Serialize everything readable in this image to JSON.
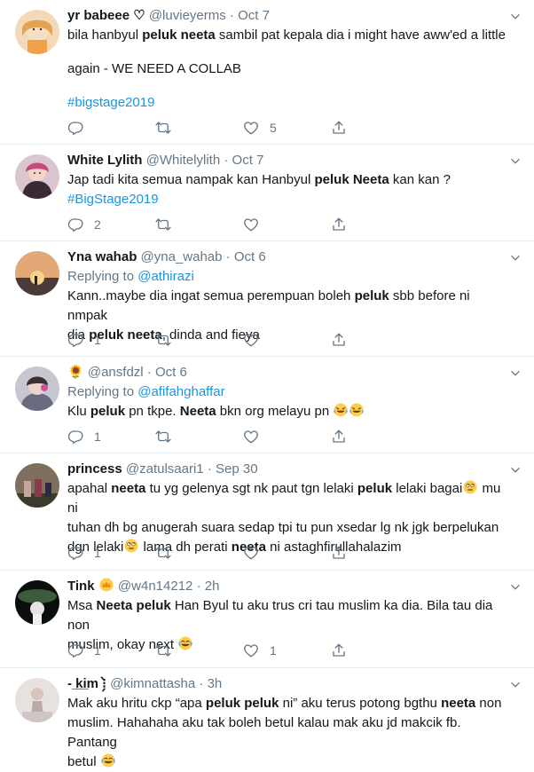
{
  "tweets": [
    {
      "name": "yr babeee ♡",
      "handle": "@luvieyerms",
      "time": "Oct 7",
      "body1_a": "bila hanbyul ",
      "body1_b": "peluk neeta",
      "body1_c": " sambil pat kepala dia i might have aww'ed a little",
      "body2": "again - WE NEED A COLLAB",
      "hashtag": "#bigstage2019",
      "reply_count": "",
      "like_count": "5"
    },
    {
      "name": "White Lylith",
      "handle": "@Whitelylith",
      "time": "Oct 7",
      "body_a": "Jap tadi kita semua nampak kan Hanbyul ",
      "body_b": "peluk Neeta",
      "body_c": " kan kan ?",
      "hashtag": "#BigStage2019",
      "reply_count": "2",
      "like_count": ""
    },
    {
      "name": "Yna wahab",
      "handle": "@yna_wahab",
      "time": "Oct 6",
      "replying_label": "Replying to",
      "replying_to": "@athirazi",
      "line1_a": "Kann..maybe dia ingat semua perempuan boleh ",
      "line1_b": "peluk",
      "line1_c": " sbb before ni nmpak",
      "line2_a": "dia ",
      "line2_b": "peluk neeta",
      "line2_c": ", dinda and fieya",
      "reply_count": "1",
      "like_count": ""
    },
    {
      "name_emoji": "🌻",
      "handle": "@ansfdzl",
      "time": "Oct 6",
      "replying_label": "Replying to",
      "replying_to": "@afifahghaffar",
      "b_a": "Klu ",
      "b_b": "peluk",
      "b_c": " pn tkpe. ",
      "b_d": "Neeta",
      "b_e": " bkn org melayu pn ",
      "emoji": "🤣🤣",
      "reply_count": "1",
      "like_count": ""
    },
    {
      "name": "princess",
      "handle": "@zatulsaari1",
      "time": "Sep 30",
      "l1_a": "apahal ",
      "l1_b": "neeta",
      "l1_c": " tu yg gelenya sgt nk paut tgn lelaki ",
      "l1_d": "peluk",
      "l1_e": " lelaki bagai",
      "l1_f": " mu ni",
      "l2": "tuhan dh bg anugerah suara sedap tpi tu pun xsedar lg nk jgk berpelukan",
      "l3_a": "dgn lelaki",
      "l3_b": " lama dh perati ",
      "l3_c": "neeta",
      "l3_d": " ni astaghfirullahalazim",
      "reply_count": "1",
      "like_count": ""
    },
    {
      "name": "Tink",
      "handle": "@w4n14212",
      "time": "2h",
      "l1_a": "Msa ",
      "l1_b": "Neeta peluk",
      "l1_c": " Han Byul tu aku trus cri tau muslim ka dia. Bila tau dia non",
      "l2": "muslim, okay next ",
      "reply_count": "1",
      "like_count": "1"
    },
    {
      "name": "- ̲k̲i̲m ⁝̗̀",
      "handle": "@kimnattasha",
      "time": "3h",
      "l1_a": "Mak aku hritu ckp “apa ",
      "l1_b": "peluk peluk",
      "l1_c": " ni” aku terus potong bgthu ",
      "l1_d": "neeta",
      "l1_e": " non",
      "l2": "muslim. Hahahaha aku tak boleh betul kalau mak aku jd makcik fb. Pantang",
      "l3": "betul "
    }
  ],
  "colors": {
    "text": "#14171a",
    "muted": "#657786",
    "link": "#1b95e0",
    "border": "#e6ecf0"
  }
}
